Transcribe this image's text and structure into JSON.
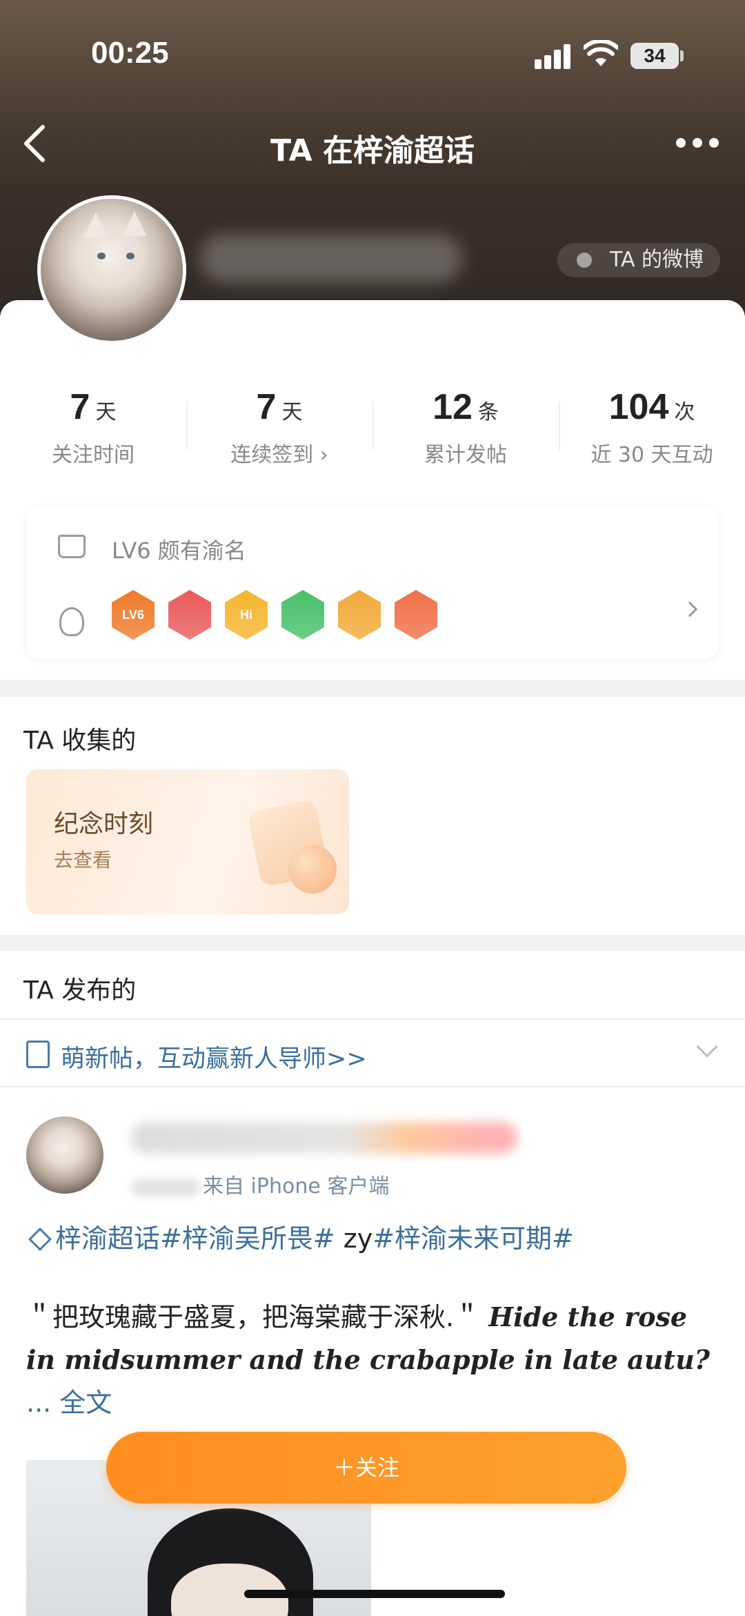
{
  "status_bar": {
    "time": "00:25",
    "battery": "34"
  },
  "nav": {
    "title": "TA 在梓渝超话"
  },
  "profile": {
    "weibo_link": "TA 的微博"
  },
  "stats": [
    {
      "num": "7",
      "unit": "天",
      "label": "关注时间"
    },
    {
      "num": "7",
      "unit": "天",
      "label": "连续签到 ›"
    },
    {
      "num": "12",
      "unit": "条",
      "label": "累计发帖"
    },
    {
      "num": "104",
      "unit": "次",
      "label": "近 30 天互动"
    }
  ],
  "level": {
    "text": "LV6 颇有渝名",
    "badges": [
      {
        "label": "LV6",
        "color": "#f07a2a"
      },
      {
        "label": "",
        "color": "#ea5a5a"
      },
      {
        "label": "Hi",
        "color": "#f5b52e"
      },
      {
        "label": "",
        "color": "#48c06a"
      },
      {
        "label": "",
        "color": "#f2a93a"
      },
      {
        "label": "",
        "color": "#f07048"
      }
    ]
  },
  "collections": {
    "title": "TA 收集的",
    "card_title": "纪念时刻",
    "card_sub": "去查看"
  },
  "posts": {
    "title": "TA 发布的",
    "notice": "萌新帖，互动赢新人导师>>",
    "source": "来自 iPhone 客户端",
    "tags": {
      "tag1": "梓渝超话",
      "tag2": "#梓渝吴所畏#",
      "plain": " zy",
      "tag3": "#梓渝未来可期#"
    },
    "body_cn": "＂把玫瑰藏于盛夏，把海棠藏于深秋.＂",
    "body_en": "Hide the rose in midsummer and the crabapple in late autu?",
    "body_more": "... 全文"
  },
  "follow_button": "＋关注",
  "colors": {
    "accent": "#ff9520",
    "link": "#3c6f9a"
  }
}
